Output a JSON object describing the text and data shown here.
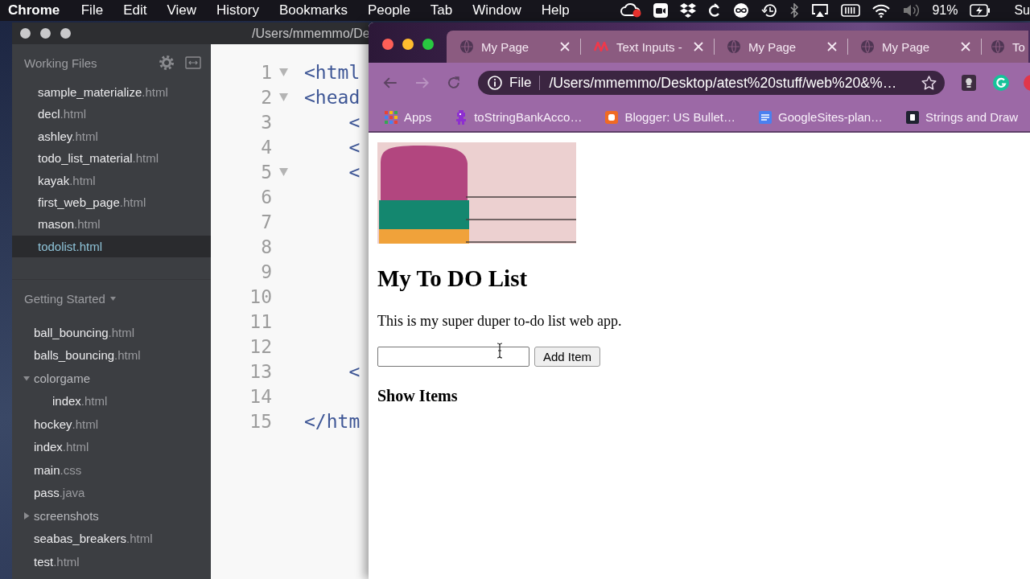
{
  "menu_bar": {
    "app_name": "Chrome",
    "menus": [
      "File",
      "Edit",
      "View",
      "History",
      "Bookmarks",
      "People",
      "Tab",
      "Window",
      "Help"
    ],
    "battery": "91%",
    "clock": "Su"
  },
  "editor": {
    "title": "/Users/mmemmo/De",
    "working_files": {
      "title": "Working Files",
      "files": [
        {
          "name": "sample_materialize",
          "ext": ".html",
          "selected": false
        },
        {
          "name": "decl",
          "ext": ".html",
          "selected": false
        },
        {
          "name": "ashley",
          "ext": ".html",
          "selected": false
        },
        {
          "name": "todo_list_material",
          "ext": ".html",
          "selected": false
        },
        {
          "name": "kayak",
          "ext": ".html",
          "selected": false
        },
        {
          "name": "first_web_page",
          "ext": ".html",
          "selected": false
        },
        {
          "name": "mason",
          "ext": ".html",
          "selected": false
        },
        {
          "name": "todolist",
          "ext": ".html",
          "selected": true
        }
      ]
    },
    "project": {
      "title": "Getting Started",
      "items": [
        {
          "kind": "file",
          "name": "ball_bouncing",
          "ext": ".html",
          "selected": false
        },
        {
          "kind": "file",
          "name": "balls_bouncing",
          "ext": ".html",
          "selected": false
        },
        {
          "kind": "folder",
          "name": "colorgame",
          "expanded": true,
          "children": [
            {
              "kind": "file",
              "name": "index",
              "ext": ".html",
              "selected": false
            }
          ]
        },
        {
          "kind": "file",
          "name": "hockey",
          "ext": ".html",
          "selected": false
        },
        {
          "kind": "file",
          "name": "index",
          "ext": ".html",
          "selected": false
        },
        {
          "kind": "file",
          "name": "main",
          "ext": ".css",
          "selected": false
        },
        {
          "kind": "file",
          "name": "pass",
          "ext": ".java",
          "selected": false
        },
        {
          "kind": "folder",
          "name": "screenshots",
          "expanded": false
        },
        {
          "kind": "file",
          "name": "seabas_breakers",
          "ext": ".html",
          "selected": false
        },
        {
          "kind": "file",
          "name": "test",
          "ext": ".html",
          "selected": false
        }
      ]
    },
    "code_lines": [
      {
        "number": "1",
        "foldable": true,
        "text": "<html"
      },
      {
        "number": "2",
        "foldable": true,
        "text": "<head"
      },
      {
        "number": "3",
        "foldable": false,
        "text": "    <"
      },
      {
        "number": "4",
        "foldable": false,
        "text": "    <"
      },
      {
        "number": "5",
        "foldable": true,
        "text": "    <"
      },
      {
        "number": "6",
        "foldable": false
      },
      {
        "number": "7",
        "foldable": false
      },
      {
        "number": "8",
        "foldable": false
      },
      {
        "number": "9",
        "foldable": false
      },
      {
        "number": "10",
        "foldable": false
      },
      {
        "number": "11",
        "foldable": false
      },
      {
        "number": "12",
        "foldable": false
      },
      {
        "number": "13",
        "foldable": false,
        "text": "    <"
      },
      {
        "number": "14",
        "foldable": false
      },
      {
        "number": "15",
        "foldable": false,
        "text": "</htm"
      }
    ]
  },
  "browser": {
    "tabs": [
      {
        "kind": "globe",
        "title": "My Page",
        "closable": true
      },
      {
        "kind": "site-logo",
        "title": "Text Inputs -",
        "closable": true
      },
      {
        "kind": "globe",
        "title": "My Page",
        "closable": true
      },
      {
        "kind": "globe",
        "title": "My Page",
        "closable": true
      },
      {
        "kind": "globe",
        "title": "To",
        "closable": false
      }
    ],
    "nav": [
      {
        "kind": "back",
        "disabled": false
      },
      {
        "kind": "forward",
        "disabled": true
      },
      {
        "kind": "reload",
        "disabled": false
      }
    ],
    "address": {
      "scheme": "File",
      "url": "/Users/mmemmo/Desktop/atest%20stuff/web%20&%…"
    },
    "bookmarks": [
      {
        "kind": "apps",
        "label": "Apps"
      },
      {
        "kind": "sprite",
        "label": "toStringBankAcco…"
      },
      {
        "kind": "blog",
        "label": "Blogger: US Bullet…"
      },
      {
        "kind": "doc",
        "label": "GoogleSites-plan…"
      },
      {
        "kind": "tile",
        "label": "Strings and Draw"
      }
    ]
  },
  "page": {
    "heading": "My To DO List",
    "paragraph": "This is my super duper to-do list web app.",
    "button": "Add Item",
    "subheading": "Show Items"
  }
}
